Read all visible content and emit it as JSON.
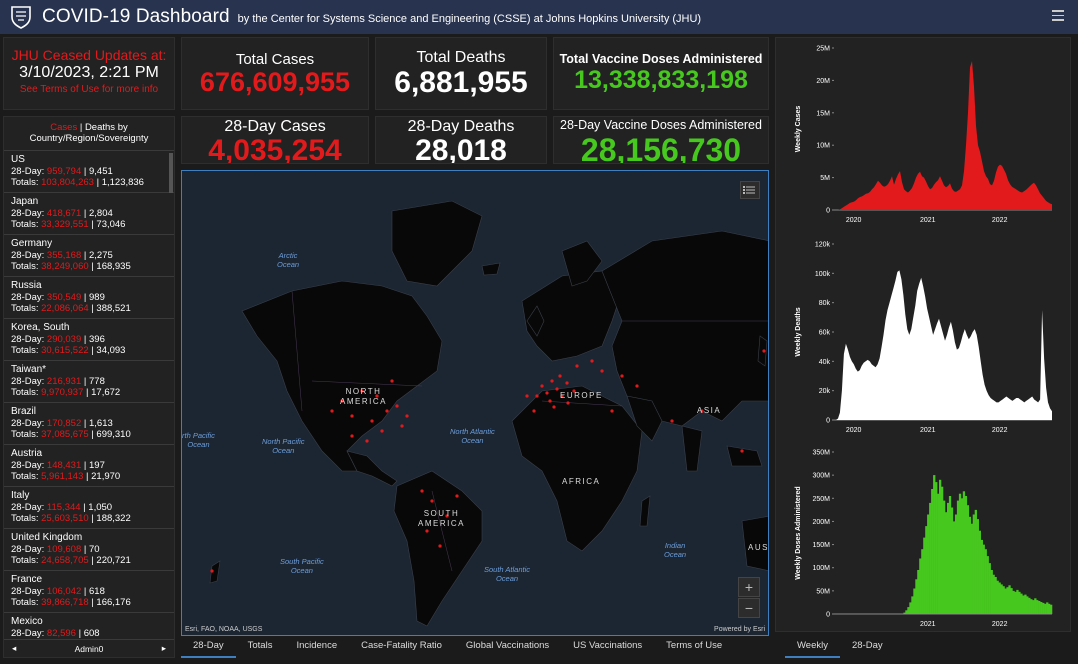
{
  "header": {
    "title": "COVID-19 Dashboard",
    "subtitle": "by the Center for Systems Science and Engineering (CSSE) at Johns Hopkins University (JHU)"
  },
  "notice": {
    "line1": "JHU Ceased Updates at:",
    "line2": "3/10/2023, 2:21 PM",
    "line3": "See Terms of Use for more info"
  },
  "stats": {
    "total_cases_label": "Total Cases",
    "total_cases": "676,609,955",
    "total_deaths_label": "Total Deaths",
    "total_deaths": "6,881,955",
    "total_vax_label": "Total Vaccine Doses Administered",
    "total_vax": "13,338,833,198",
    "cases28_label": "28-Day Cases",
    "cases28": "4,035,254",
    "deaths28_label": "28-Day Deaths",
    "deaths28": "28,018",
    "vax28_label": "28-Day Vaccine Doses Administered",
    "vax28": "28,156,730"
  },
  "list": {
    "head_cases": "Cases",
    "head_rest": " | Deaths by",
    "head_line2": "Country/Region/Sovereignty",
    "footer_label": "Admin0",
    "countries": [
      {
        "name": "US",
        "c28": "959,794",
        "d28": "9,451",
        "ct": "103,804,263",
        "dt": "1,123,836"
      },
      {
        "name": "Japan",
        "c28": "418,671",
        "d28": "2,804",
        "ct": "33,329,551",
        "dt": "73,046"
      },
      {
        "name": "Germany",
        "c28": "355,168",
        "d28": "2,275",
        "ct": "38,249,060",
        "dt": "168,935"
      },
      {
        "name": "Russia",
        "c28": "350,549",
        "d28": "989",
        "ct": "22,086,064",
        "dt": "388,521"
      },
      {
        "name": "Korea, South",
        "c28": "290,039",
        "d28": "396",
        "ct": "30,615,522",
        "dt": "34,093"
      },
      {
        "name": "Taiwan*",
        "c28": "216,931",
        "d28": "778",
        "ct": "9,970,937",
        "dt": "17,672"
      },
      {
        "name": "Brazil",
        "c28": "170,852",
        "d28": "1,613",
        "ct": "37,085,675",
        "dt": "699,310"
      },
      {
        "name": "Austria",
        "c28": "148,431",
        "d28": "197",
        "ct": "5,961,143",
        "dt": "21,970"
      },
      {
        "name": "Italy",
        "c28": "115,344",
        "d28": "1,050",
        "ct": "25,603,510",
        "dt": "188,322"
      },
      {
        "name": "United Kingdom",
        "c28": "109,608",
        "d28": "70",
        "ct": "24,658,705",
        "dt": "220,721"
      },
      {
        "name": "France",
        "c28": "106,042",
        "d28": "618",
        "ct": "39,866,718",
        "dt": "166,176"
      },
      {
        "name": "Mexico",
        "c28": "82,596",
        "d28": "608",
        "ct": "",
        "dt": ""
      }
    ],
    "prefix_28": "28-Day: ",
    "prefix_tot": "Totals: "
  },
  "map": {
    "attribution": "Esri, FAO, NOAA, USGS",
    "powered": "Powered by Esri",
    "zoom_in": "+",
    "zoom_out": "−",
    "labels": {
      "arctic": "Arctic\nOcean",
      "npac_left": "rth Pacific\nOcean",
      "npac": "North Pacific\nOcean",
      "natl": "North Atlantic\nOcean",
      "spac": "South Pacific\nOcean",
      "satl": "South Atlantic\nOcean",
      "indian": "Indian\nOcean",
      "namerica": "NORTH\nAMERICA",
      "samerica": "SOUTH\nAMERICA",
      "europe": "EUROPE",
      "africa": "AFRICA",
      "asia": "ASIA",
      "aus": "AUS"
    }
  },
  "bottom_tabs": [
    "28-Day",
    "Totals",
    "Incidence",
    "Case-Fatality Ratio",
    "Global Vaccinations",
    "US Vaccinations",
    "Terms of Use"
  ],
  "chart_tabs": [
    "Weekly",
    "28-Day"
  ],
  "colors": {
    "cases": "#e31a1c",
    "deaths": "#ffffff",
    "vax": "#46c81e",
    "header": "#28334f",
    "accent": "#3d7fc1"
  },
  "chart_data": [
    {
      "type": "area",
      "ylabel": "Weekly Cases",
      "yticks": [
        "0",
        "5M",
        "10M",
        "15M",
        "20M",
        "25M"
      ],
      "ylim": [
        0,
        25000000
      ],
      "xticks": [
        "2020",
        "2021",
        "2022"
      ],
      "x_range": [
        "2020-01",
        "2023-03"
      ],
      "series": [
        {
          "values": [
            0,
            0,
            0,
            100000,
            300000,
            500000,
            700000,
            900000,
            1100000,
            1200000,
            1300000,
            1500000,
            1800000,
            2000000,
            2100000,
            2300000,
            2500000,
            2600000,
            2800000,
            3200000,
            3500000,
            4000000,
            4500000,
            4200000,
            3800000,
            3600000,
            3700000,
            4000000,
            4500000,
            5200000,
            3900000,
            4800000,
            5500000,
            6000000,
            4300000,
            3200000,
            2900000,
            2700000,
            3000000,
            3400000,
            4100000,
            5000000,
            5600000,
            5900000,
            5200000,
            5000000,
            4400000,
            3700000,
            3200000,
            3400000,
            3900000,
            4300000,
            4600000,
            5200000,
            4500000,
            3800000,
            3500000,
            3700000,
            4100000,
            3300000,
            2900000,
            2800000,
            3000000,
            3200000,
            3800000,
            6000000,
            10000000,
            15000000,
            22000000,
            23000000,
            19000000,
            13000000,
            10000000,
            9000000,
            7500000,
            6000000,
            5200000,
            4800000,
            4000000,
            3800000,
            4500000,
            5800000,
            6700000,
            7000000,
            6800000,
            6200000,
            5600000,
            4600000,
            4000000,
            3600000,
            3400000,
            3200000,
            3000000,
            2800000,
            2700000,
            2900000,
            3100000,
            3400000,
            3700000,
            4000000,
            4200000,
            3800000,
            3200000,
            2600000,
            2200000,
            1800000,
            1400000,
            1200000,
            1000000,
            900000
          ]
        }
      ]
    },
    {
      "type": "area",
      "ylabel": "Weekly Deaths",
      "yticks": [
        "0",
        "20k",
        "40k",
        "60k",
        "80k",
        "100k",
        "120k"
      ],
      "ylim": [
        0,
        120000
      ],
      "xticks": [
        "2020",
        "2021",
        "2022"
      ],
      "x_range": [
        "2020-01",
        "2023-03"
      ],
      "series": [
        {
          "values": [
            0,
            0,
            1000,
            5000,
            20000,
            45000,
            52000,
            48000,
            43000,
            40000,
            38000,
            35000,
            33000,
            34000,
            37000,
            39000,
            40000,
            41000,
            40000,
            38000,
            37000,
            36000,
            38000,
            42000,
            50000,
            58000,
            68000,
            75000,
            80000,
            85000,
            90000,
            95000,
            101000,
            102000,
            96000,
            85000,
            72000,
            62000,
            58000,
            62000,
            70000,
            78000,
            88000,
            93000,
            97000,
            91000,
            84000,
            76000,
            70000,
            64000,
            58000,
            62000,
            66000,
            69000,
            64000,
            59000,
            54000,
            58000,
            63000,
            67000,
            61000,
            53000,
            48000,
            49000,
            53000,
            58000,
            62000,
            58000,
            55000,
            57000,
            60000,
            62000,
            58000,
            50000,
            40000,
            31000,
            24000,
            20000,
            17000,
            15000,
            14000,
            13000,
            12000,
            12000,
            13000,
            14000,
            15000,
            16000,
            15000,
            14000,
            13000,
            14000,
            15000,
            15000,
            14000,
            13000,
            12000,
            13000,
            14000,
            15000,
            16000,
            14000,
            13000,
            12000,
            14000,
            75000,
            42000,
            22000,
            12000,
            8000,
            6000
          ]
        }
      ]
    },
    {
      "type": "bar",
      "ylabel": "Weekly Doses Administered",
      "yticks": [
        "0",
        "50M",
        "100M",
        "150M",
        "200M",
        "250M",
        "300M",
        "350M"
      ],
      "ylim": [
        0,
        350000000
      ],
      "xticks": [
        "2021",
        "2022"
      ],
      "x_range": [
        "2020-01",
        "2023-03"
      ],
      "series": [
        {
          "values": [
            0,
            0,
            0,
            0,
            0,
            0,
            0,
            0,
            0,
            0,
            0,
            0,
            0,
            0,
            0,
            0,
            0,
            0,
            0,
            0,
            0,
            0,
            0,
            0,
            0,
            0,
            0,
            0,
            0,
            0,
            0,
            0,
            0,
            0,
            1000000,
            3000000,
            8000000,
            15000000,
            25000000,
            38000000,
            55000000,
            75000000,
            95000000,
            120000000,
            140000000,
            165000000,
            190000000,
            215000000,
            240000000,
            270000000,
            300000000,
            285000000,
            260000000,
            290000000,
            275000000,
            245000000,
            220000000,
            240000000,
            255000000,
            230000000,
            200000000,
            215000000,
            245000000,
            260000000,
            250000000,
            265000000,
            255000000,
            235000000,
            210000000,
            195000000,
            215000000,
            225000000,
            205000000,
            180000000,
            160000000,
            150000000,
            140000000,
            125000000,
            110000000,
            95000000,
            85000000,
            80000000,
            72000000,
            68000000,
            64000000,
            60000000,
            55000000,
            58000000,
            62000000,
            56000000,
            50000000,
            48000000,
            52000000,
            48000000,
            44000000,
            40000000,
            42000000,
            38000000,
            35000000,
            32000000,
            30000000,
            34000000,
            30000000,
            28000000,
            26000000,
            24000000,
            22000000,
            25000000,
            22000000,
            20000000
          ]
        }
      ]
    }
  ]
}
